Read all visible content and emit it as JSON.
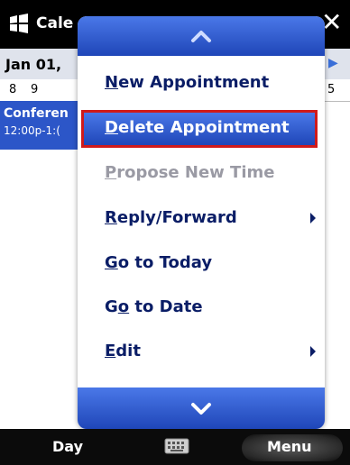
{
  "title_bar": {
    "app_title": "Cale",
    "close_glyph": "✕",
    "logo_icon": "windows-flag-icon"
  },
  "calendar": {
    "date_label": "Jan 01, ",
    "hours": [
      "8",
      "9"
    ],
    "hour_end": "5",
    "appointment": {
      "title": "Conferen",
      "time": "12:00p-1:("
    }
  },
  "menu": {
    "up_icon": "chevron-up-icon",
    "down_icon": "chevron-down-icon",
    "items": [
      {
        "label": "New Appointment",
        "mnemonic": "N",
        "rest": "ew Appointment",
        "enabled": true,
        "selected": false,
        "submenu": false
      },
      {
        "label": "Delete Appointment",
        "mnemonic": "D",
        "rest": "elete Appointment",
        "enabled": true,
        "selected": true,
        "submenu": false
      },
      {
        "label": "Propose New Time",
        "mnemonic": "P",
        "rest": "ropose New Time",
        "enabled": false,
        "selected": false,
        "submenu": false
      },
      {
        "label": "Reply/Forward",
        "mnemonic": "R",
        "rest": "eply/Forward",
        "enabled": true,
        "selected": false,
        "submenu": true
      },
      {
        "label": "Go to Today",
        "mnemonic": "G",
        "rest": "o to Today",
        "enabled": true,
        "selected": false,
        "submenu": false
      },
      {
        "label": "Go to Date",
        "pre": "G",
        "mnemonic": "o",
        "rest": " to Date",
        "enabled": true,
        "selected": false,
        "submenu": false
      },
      {
        "label": "Edit",
        "mnemonic": "E",
        "rest": "dit",
        "enabled": true,
        "selected": false,
        "submenu": true
      }
    ]
  },
  "bottom_bar": {
    "left_softkey": "Day",
    "right_softkey": "Menu",
    "keyboard_icon": "keyboard-icon"
  },
  "colors": {
    "menu_blue": "#1f46b8",
    "selection_border": "#d01a1a",
    "menu_text": "#0a1d66",
    "disabled_text": "#9a9aa4"
  }
}
